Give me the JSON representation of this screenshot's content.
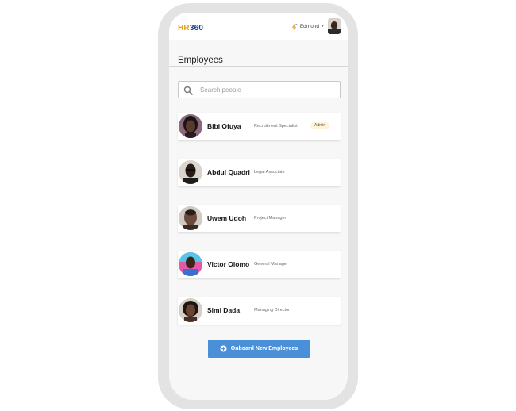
{
  "app": {
    "logo_hr": "HR",
    "logo_num": "360"
  },
  "header": {
    "user_name": "Edmond",
    "icons": [
      "bell-icon",
      "chevron-down-icon",
      "avatar"
    ]
  },
  "page": {
    "title": "Employees"
  },
  "search": {
    "placeholder": "Search people",
    "value": ""
  },
  "employees": [
    {
      "name": "Bibi Ofuya",
      "role": "Recruitment Specialist",
      "badge": "Admin"
    },
    {
      "name": "Abdul Quadri",
      "role": "Legal Associate"
    },
    {
      "name": "Uwem Udoh",
      "role": "Project Manager"
    },
    {
      "name": "Victor Olomo",
      "role": "General Manager"
    },
    {
      "name": "Simi Dada",
      "role": "Managing Director"
    }
  ],
  "actions": {
    "onboard_label": "Onboard New Employees"
  },
  "colors": {
    "brand_orange": "#e9a11a",
    "brand_navy": "#1e3f8a",
    "primary_button": "#4a90d9",
    "badge_bg": "#fff4d9"
  }
}
